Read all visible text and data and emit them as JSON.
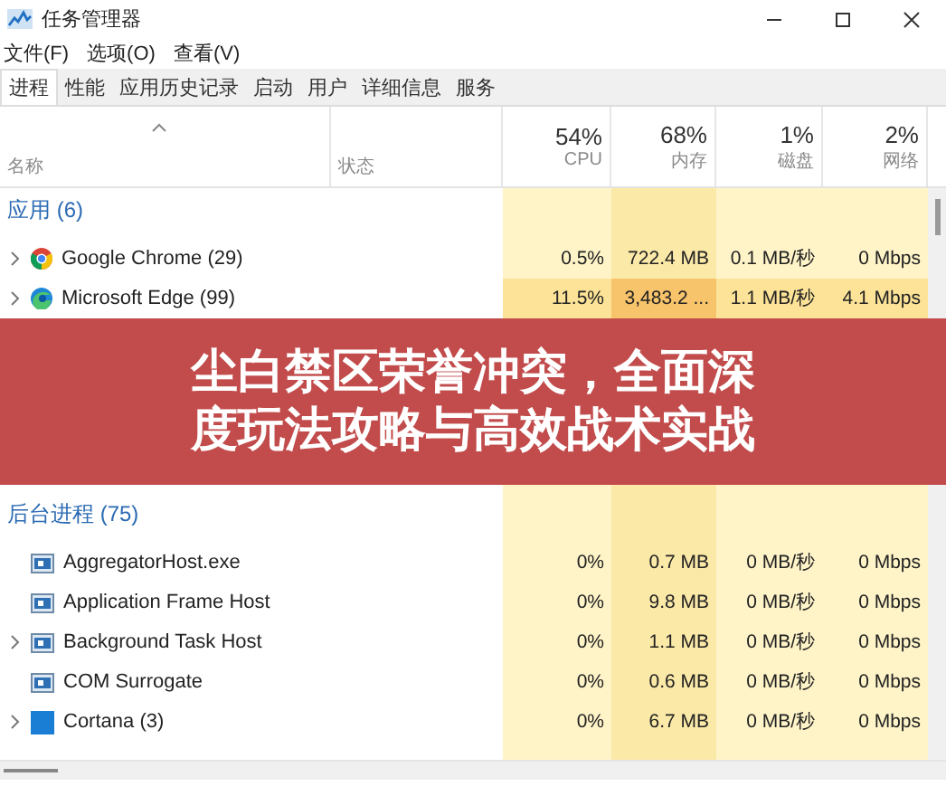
{
  "window": {
    "title": "任务管理器"
  },
  "menu": [
    "文件(F)",
    "选项(O)",
    "查看(V)"
  ],
  "tabs": [
    {
      "label": "进程",
      "selected": true
    },
    {
      "label": "性能",
      "selected": false
    },
    {
      "label": "应用历史记录",
      "selected": false
    },
    {
      "label": "启动",
      "selected": false
    },
    {
      "label": "用户",
      "selected": false
    },
    {
      "label": "详细信息",
      "selected": false
    },
    {
      "label": "服务",
      "selected": false
    }
  ],
  "name_column": {
    "label": "名称",
    "sorted": true
  },
  "status_column": {
    "label": "状态"
  },
  "metric_columns": [
    {
      "usage": "54%",
      "label": "CPU"
    },
    {
      "usage": "68%",
      "label": "内存"
    },
    {
      "usage": "1%",
      "label": "磁盘"
    },
    {
      "usage": "2%",
      "label": "网络"
    }
  ],
  "groups": [
    {
      "title": "应用 (6)",
      "processes": [
        {
          "name": "Google Chrome (29)",
          "kind": "chrome",
          "expandable": true,
          "highlight": false,
          "values": [
            "0.5%",
            "722.4 MB",
            "0.1 MB/秒",
            "0 Mbps"
          ]
        },
        {
          "name": "Microsoft Edge (99)",
          "kind": "edge",
          "expandable": true,
          "highlight": true,
          "values": [
            "11.5%",
            "3,483.2 ...",
            "1.1 MB/秒",
            "4.1 Mbps"
          ]
        }
      ]
    },
    {
      "title": "后台进程 (75)",
      "processes": [
        {
          "name": "AggregatorHost.exe",
          "kind": "window",
          "expandable": false,
          "highlight": false,
          "values": [
            "0%",
            "0.7 MB",
            "0 MB/秒",
            "0 Mbps"
          ]
        },
        {
          "name": "Application Frame Host",
          "kind": "window",
          "expandable": false,
          "highlight": false,
          "values": [
            "0%",
            "9.8 MB",
            "0 MB/秒",
            "0 Mbps"
          ]
        },
        {
          "name": "Background Task Host",
          "kind": "window",
          "expandable": true,
          "highlight": false,
          "values": [
            "0%",
            "1.1 MB",
            "0 MB/秒",
            "0 Mbps"
          ]
        },
        {
          "name": "COM Surrogate",
          "kind": "window",
          "expandable": false,
          "highlight": false,
          "values": [
            "0%",
            "0.6 MB",
            "0 MB/秒",
            "0 Mbps"
          ]
        },
        {
          "name": "Cortana (3)",
          "kind": "square",
          "expandable": true,
          "highlight": false,
          "values": [
            "0%",
            "6.7 MB",
            "0 MB/秒",
            "0 Mbps"
          ]
        }
      ]
    }
  ],
  "banner": {
    "text": "尘白禁区荣誉冲突，全面深度玩法攻略与高效战术实战"
  }
}
